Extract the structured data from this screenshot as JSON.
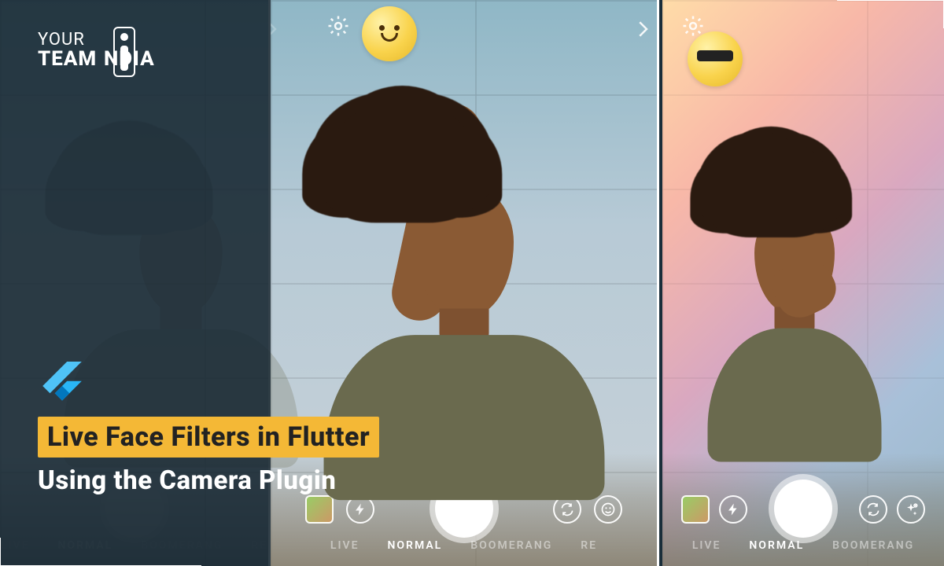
{
  "brand": {
    "line1": "YOUR",
    "line2": "TEAM",
    "line3": "NDIA"
  },
  "headline": {
    "line1": "Live Face Filters in Flutter",
    "line2": "Using the Camera Plugin"
  },
  "camera": {
    "modes": {
      "live": "LIVE",
      "normal": "NORMAL",
      "boomerang": "BOOMERANG",
      "partial": "RE"
    },
    "selected": "NORMAL"
  },
  "icons": {
    "settings": "settings-gear",
    "chevron_right": "chevron-right",
    "flash": "flash",
    "switch_cam": "switch-camera",
    "face_filter": "face-filter-smiley",
    "sparkle_add": "sparkle-add"
  },
  "emoji": {
    "mid": "blush-smile",
    "right": "sunglasses"
  }
}
